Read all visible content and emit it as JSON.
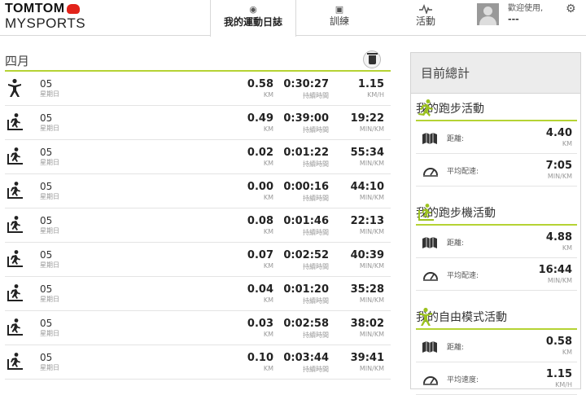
{
  "brand": {
    "top": "TOMTOM",
    "bottom": "MYSPORTS"
  },
  "nav": {
    "tabs": [
      {
        "label": "我的運動日誌",
        "icon": "clock-icon"
      },
      {
        "label": "訓練",
        "icon": "clipboard-icon"
      },
      {
        "label": "活動",
        "icon": "pulse-icon"
      }
    ]
  },
  "user": {
    "greeting": "歡迎使用,",
    "name": "---"
  },
  "log": {
    "month": "四月",
    "units": {
      "distance": "KM",
      "duration": "持續時間",
      "pace": "MIN/KM",
      "speed": "KM/H"
    },
    "rows": [
      {
        "type": "freestyle",
        "day": "05",
        "weekday": "星期日",
        "distance": "0.58",
        "duration": "0:30:27",
        "rate": "1.15",
        "rate_unit": "KM/H"
      },
      {
        "type": "treadmill",
        "day": "05",
        "weekday": "星期日",
        "distance": "0.49",
        "duration": "0:39:00",
        "rate": "19:22",
        "rate_unit": "MIN/KM"
      },
      {
        "type": "treadmill",
        "day": "05",
        "weekday": "星期日",
        "distance": "0.02",
        "duration": "0:01:22",
        "rate": "55:34",
        "rate_unit": "MIN/KM"
      },
      {
        "type": "treadmill",
        "day": "05",
        "weekday": "星期日",
        "distance": "0.00",
        "duration": "0:00:16",
        "rate": "44:10",
        "rate_unit": "MIN/KM"
      },
      {
        "type": "treadmill",
        "day": "05",
        "weekday": "星期日",
        "distance": "0.08",
        "duration": "0:01:46",
        "rate": "22:13",
        "rate_unit": "MIN/KM"
      },
      {
        "type": "treadmill",
        "day": "05",
        "weekday": "星期日",
        "distance": "0.07",
        "duration": "0:02:52",
        "rate": "40:39",
        "rate_unit": "MIN/KM"
      },
      {
        "type": "treadmill",
        "day": "05",
        "weekday": "星期日",
        "distance": "0.04",
        "duration": "0:01:20",
        "rate": "35:28",
        "rate_unit": "MIN/KM"
      },
      {
        "type": "treadmill",
        "day": "05",
        "weekday": "星期日",
        "distance": "0.03",
        "duration": "0:02:58",
        "rate": "38:02",
        "rate_unit": "MIN/KM"
      },
      {
        "type": "treadmill",
        "day": "05",
        "weekday": "星期日",
        "distance": "0.10",
        "duration": "0:03:44",
        "rate": "39:41",
        "rate_unit": "MIN/KM"
      }
    ]
  },
  "totals": {
    "title": "目前總計",
    "sections": [
      {
        "title": "我的跑步活動",
        "icon": "running-icon",
        "stats": [
          {
            "label": "距離:",
            "value": "4.40",
            "unit": "KM",
            "icon": "map-icon"
          },
          {
            "label": "平均配速:",
            "value": "7:05",
            "unit": "MIN/KM",
            "icon": "speedometer-icon"
          }
        ]
      },
      {
        "title": "我的跑步機活動",
        "icon": "treadmill-icon",
        "stats": [
          {
            "label": "距離:",
            "value": "4.88",
            "unit": "KM",
            "icon": "map-icon"
          },
          {
            "label": "平均配速:",
            "value": "16:44",
            "unit": "MIN/KM",
            "icon": "speedometer-icon"
          }
        ]
      },
      {
        "title": "我的自由模式活動",
        "icon": "freestyle-icon",
        "stats": [
          {
            "label": "距離:",
            "value": "0.58",
            "unit": "KM",
            "icon": "map-icon"
          },
          {
            "label": "平均速度:",
            "value": "1.15",
            "unit": "KM/H",
            "icon": "speedometer-icon"
          }
        ]
      }
    ]
  },
  "colors": {
    "accent": "#b5d334",
    "text": "#333333",
    "muted": "#999999"
  }
}
